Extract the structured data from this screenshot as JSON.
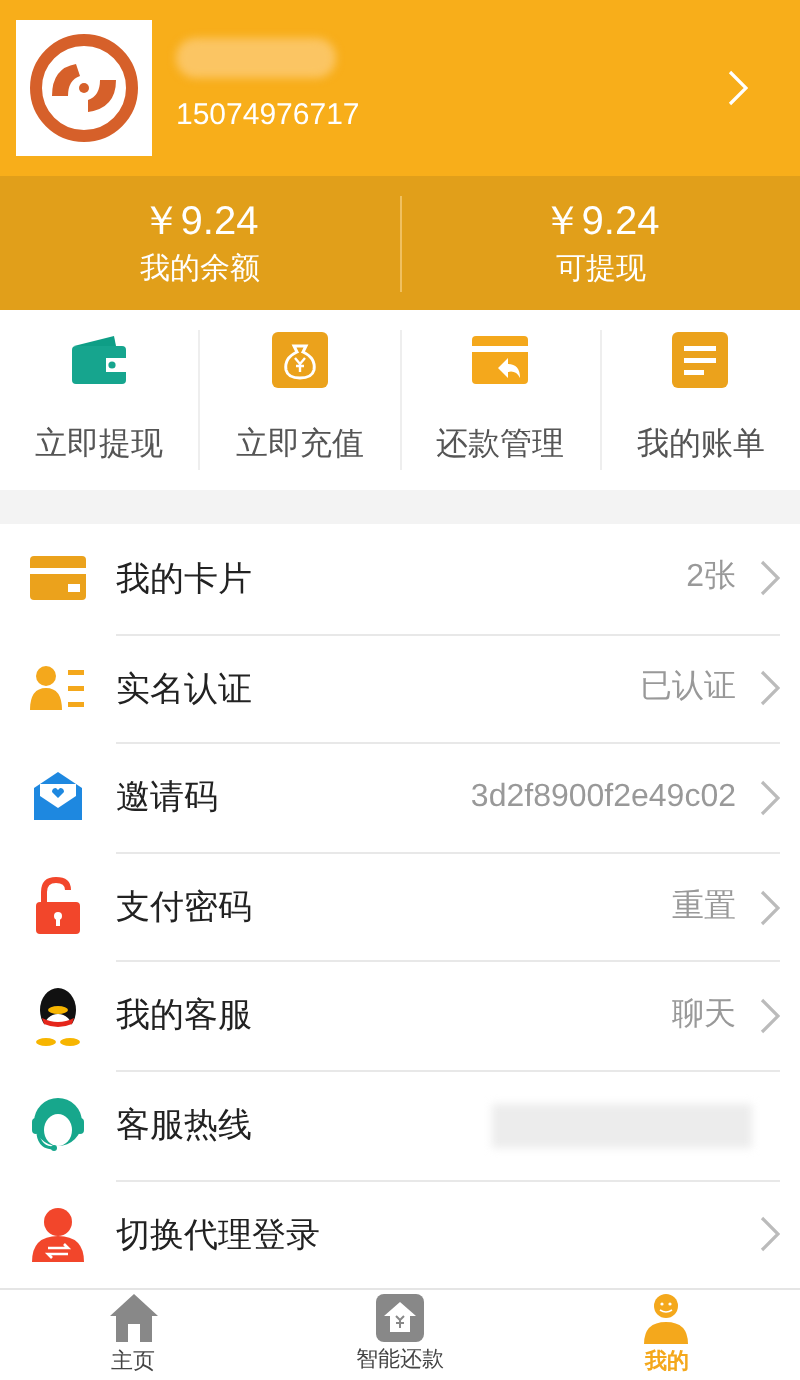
{
  "profile": {
    "name_redacted": true,
    "phone": "15074976717"
  },
  "balances": [
    {
      "amount": "￥9.24",
      "label": "我的余额"
    },
    {
      "amount": "￥9.24",
      "label": "可提现"
    }
  ],
  "actions": [
    {
      "kind": "wallet",
      "label": "立即提现"
    },
    {
      "kind": "moneybag",
      "label": "立即充值"
    },
    {
      "kind": "repay",
      "label": "还款管理"
    },
    {
      "kind": "bill",
      "label": "我的账单"
    }
  ],
  "menu": [
    {
      "kind": "card",
      "label": "我的卡片",
      "value": "2张",
      "chevron": true
    },
    {
      "kind": "idcard",
      "label": "实名认证",
      "value": "已认证",
      "chevron": true
    },
    {
      "kind": "envelope",
      "label": "邀请码",
      "value": "3d2f8900f2e49c02",
      "chevron": true
    },
    {
      "kind": "lock",
      "label": "支付密码",
      "value": "重置",
      "chevron": true
    },
    {
      "kind": "penguin",
      "label": "我的客服",
      "value": "聊天",
      "chevron": true
    },
    {
      "kind": "headset",
      "label": "客服热线",
      "redacted": true,
      "chevron": false
    },
    {
      "kind": "agent",
      "label": "切换代理登录",
      "chevron": true
    }
  ],
  "tabs": [
    {
      "kind": "home",
      "label": "主页",
      "selected": false
    },
    {
      "kind": "repay",
      "label": "智能还款",
      "selected": false
    },
    {
      "kind": "me",
      "label": "我的",
      "selected": true
    }
  ]
}
